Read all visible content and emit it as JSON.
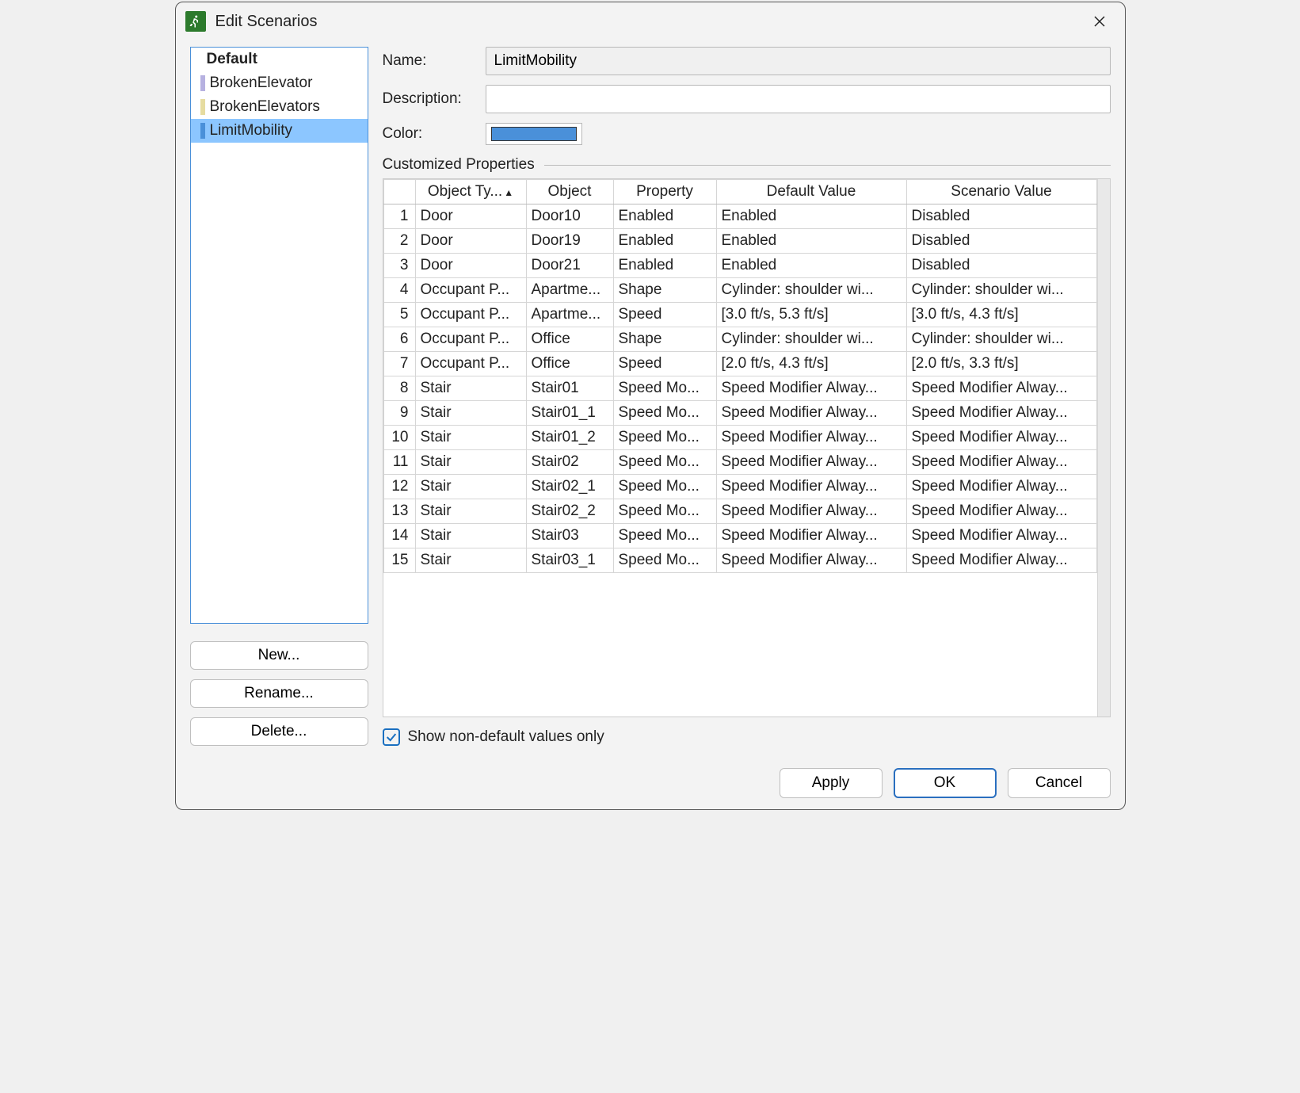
{
  "window": {
    "title": "Edit Scenarios"
  },
  "sidebar": {
    "items": [
      {
        "label": "Default",
        "default": true,
        "color": null,
        "selected": false
      },
      {
        "label": "BrokenElevator",
        "default": false,
        "color": "#b6b1e0",
        "selected": false
      },
      {
        "label": "BrokenElevators",
        "default": false,
        "color": "#e6dca0",
        "selected": false
      },
      {
        "label": "LimitMobility",
        "default": false,
        "color": "#4a90d9",
        "selected": true
      }
    ],
    "buttons": {
      "new": "New...",
      "rename": "Rename...",
      "delete": "Delete..."
    }
  },
  "form": {
    "name_label": "Name:",
    "name_value": "LimitMobility",
    "description_label": "Description:",
    "description_value": "",
    "color_label": "Color:",
    "color_value": "#4a90d9"
  },
  "section": {
    "customized_properties": "Customized Properties"
  },
  "table": {
    "columns": [
      "Object Ty...",
      "Object",
      "Property",
      "Default Value",
      "Scenario Value"
    ],
    "sort_indicator_col": 0,
    "rows": [
      {
        "n": 1,
        "cells": [
          "Door",
          "Door10",
          "Enabled",
          "Enabled",
          "Disabled"
        ]
      },
      {
        "n": 2,
        "cells": [
          "Door",
          "Door19",
          "Enabled",
          "Enabled",
          "Disabled"
        ]
      },
      {
        "n": 3,
        "cells": [
          "Door",
          "Door21",
          "Enabled",
          "Enabled",
          "Disabled"
        ]
      },
      {
        "n": 4,
        "cells": [
          "Occupant P...",
          "Apartme...",
          "Shape",
          "Cylinder: shoulder wi...",
          "Cylinder: shoulder wi..."
        ]
      },
      {
        "n": 5,
        "cells": [
          "Occupant P...",
          "Apartme...",
          "Speed",
          "[3.0 ft/s, 5.3 ft/s]",
          "[3.0 ft/s, 4.3 ft/s]"
        ]
      },
      {
        "n": 6,
        "cells": [
          "Occupant P...",
          "Office",
          "Shape",
          "Cylinder: shoulder wi...",
          "Cylinder: shoulder wi..."
        ]
      },
      {
        "n": 7,
        "cells": [
          "Occupant P...",
          "Office",
          "Speed",
          "[2.0 ft/s, 4.3 ft/s]",
          "[2.0 ft/s, 3.3 ft/s]"
        ]
      },
      {
        "n": 8,
        "cells": [
          "Stair",
          "Stair01",
          "Speed Mo...",
          "Speed Modifier Alway...",
          "Speed Modifier Alway..."
        ]
      },
      {
        "n": 9,
        "cells": [
          "Stair",
          "Stair01_1",
          "Speed Mo...",
          "Speed Modifier Alway...",
          "Speed Modifier Alway..."
        ]
      },
      {
        "n": 10,
        "cells": [
          "Stair",
          "Stair01_2",
          "Speed Mo...",
          "Speed Modifier Alway...",
          "Speed Modifier Alway..."
        ]
      },
      {
        "n": 11,
        "cells": [
          "Stair",
          "Stair02",
          "Speed Mo...",
          "Speed Modifier Alway...",
          "Speed Modifier Alway..."
        ]
      },
      {
        "n": 12,
        "cells": [
          "Stair",
          "Stair02_1",
          "Speed Mo...",
          "Speed Modifier Alway...",
          "Speed Modifier Alway..."
        ]
      },
      {
        "n": 13,
        "cells": [
          "Stair",
          "Stair02_2",
          "Speed Mo...",
          "Speed Modifier Alway...",
          "Speed Modifier Alway..."
        ]
      },
      {
        "n": 14,
        "cells": [
          "Stair",
          "Stair03",
          "Speed Mo...",
          "Speed Modifier Alway...",
          "Speed Modifier Alway..."
        ]
      },
      {
        "n": 15,
        "cells": [
          "Stair",
          "Stair03_1",
          "Speed Mo...",
          "Speed Modifier Alway...",
          "Speed Modifier Alway..."
        ]
      }
    ]
  },
  "below_table": {
    "show_non_default_label": "Show non-default values only",
    "show_non_default_checked": true
  },
  "footer": {
    "apply": "Apply",
    "ok": "OK",
    "cancel": "Cancel"
  }
}
